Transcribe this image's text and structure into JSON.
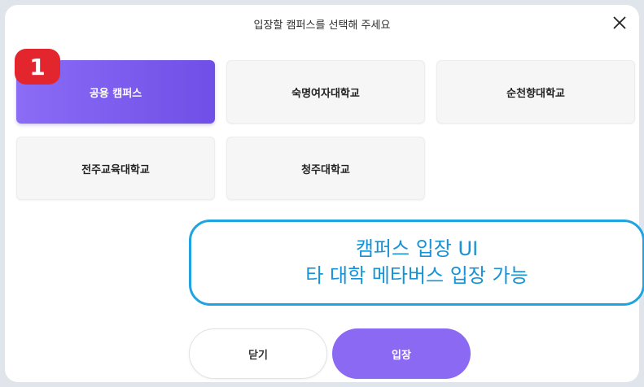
{
  "modal": {
    "title": "입장할 캠퍼스를 선택해 주세요",
    "close_icon": "close-icon"
  },
  "step_badge": "1",
  "campuses": [
    {
      "label": "공용 캠퍼스",
      "selected": true
    },
    {
      "label": "숙명여자대학교",
      "selected": false
    },
    {
      "label": "순천향대학교",
      "selected": false
    },
    {
      "label": "전주교육대학교",
      "selected": false
    },
    {
      "label": "청주대학교",
      "selected": false
    }
  ],
  "callout": {
    "line1": "캠퍼스 입장 UI",
    "line2": "타 대학 메타버스 입장 가능"
  },
  "buttons": {
    "close_label": "닫기",
    "enter_label": "입장"
  },
  "colors": {
    "accent": "#8c69f3",
    "badge": "#e3262d",
    "callout": "#1fa3e2"
  }
}
